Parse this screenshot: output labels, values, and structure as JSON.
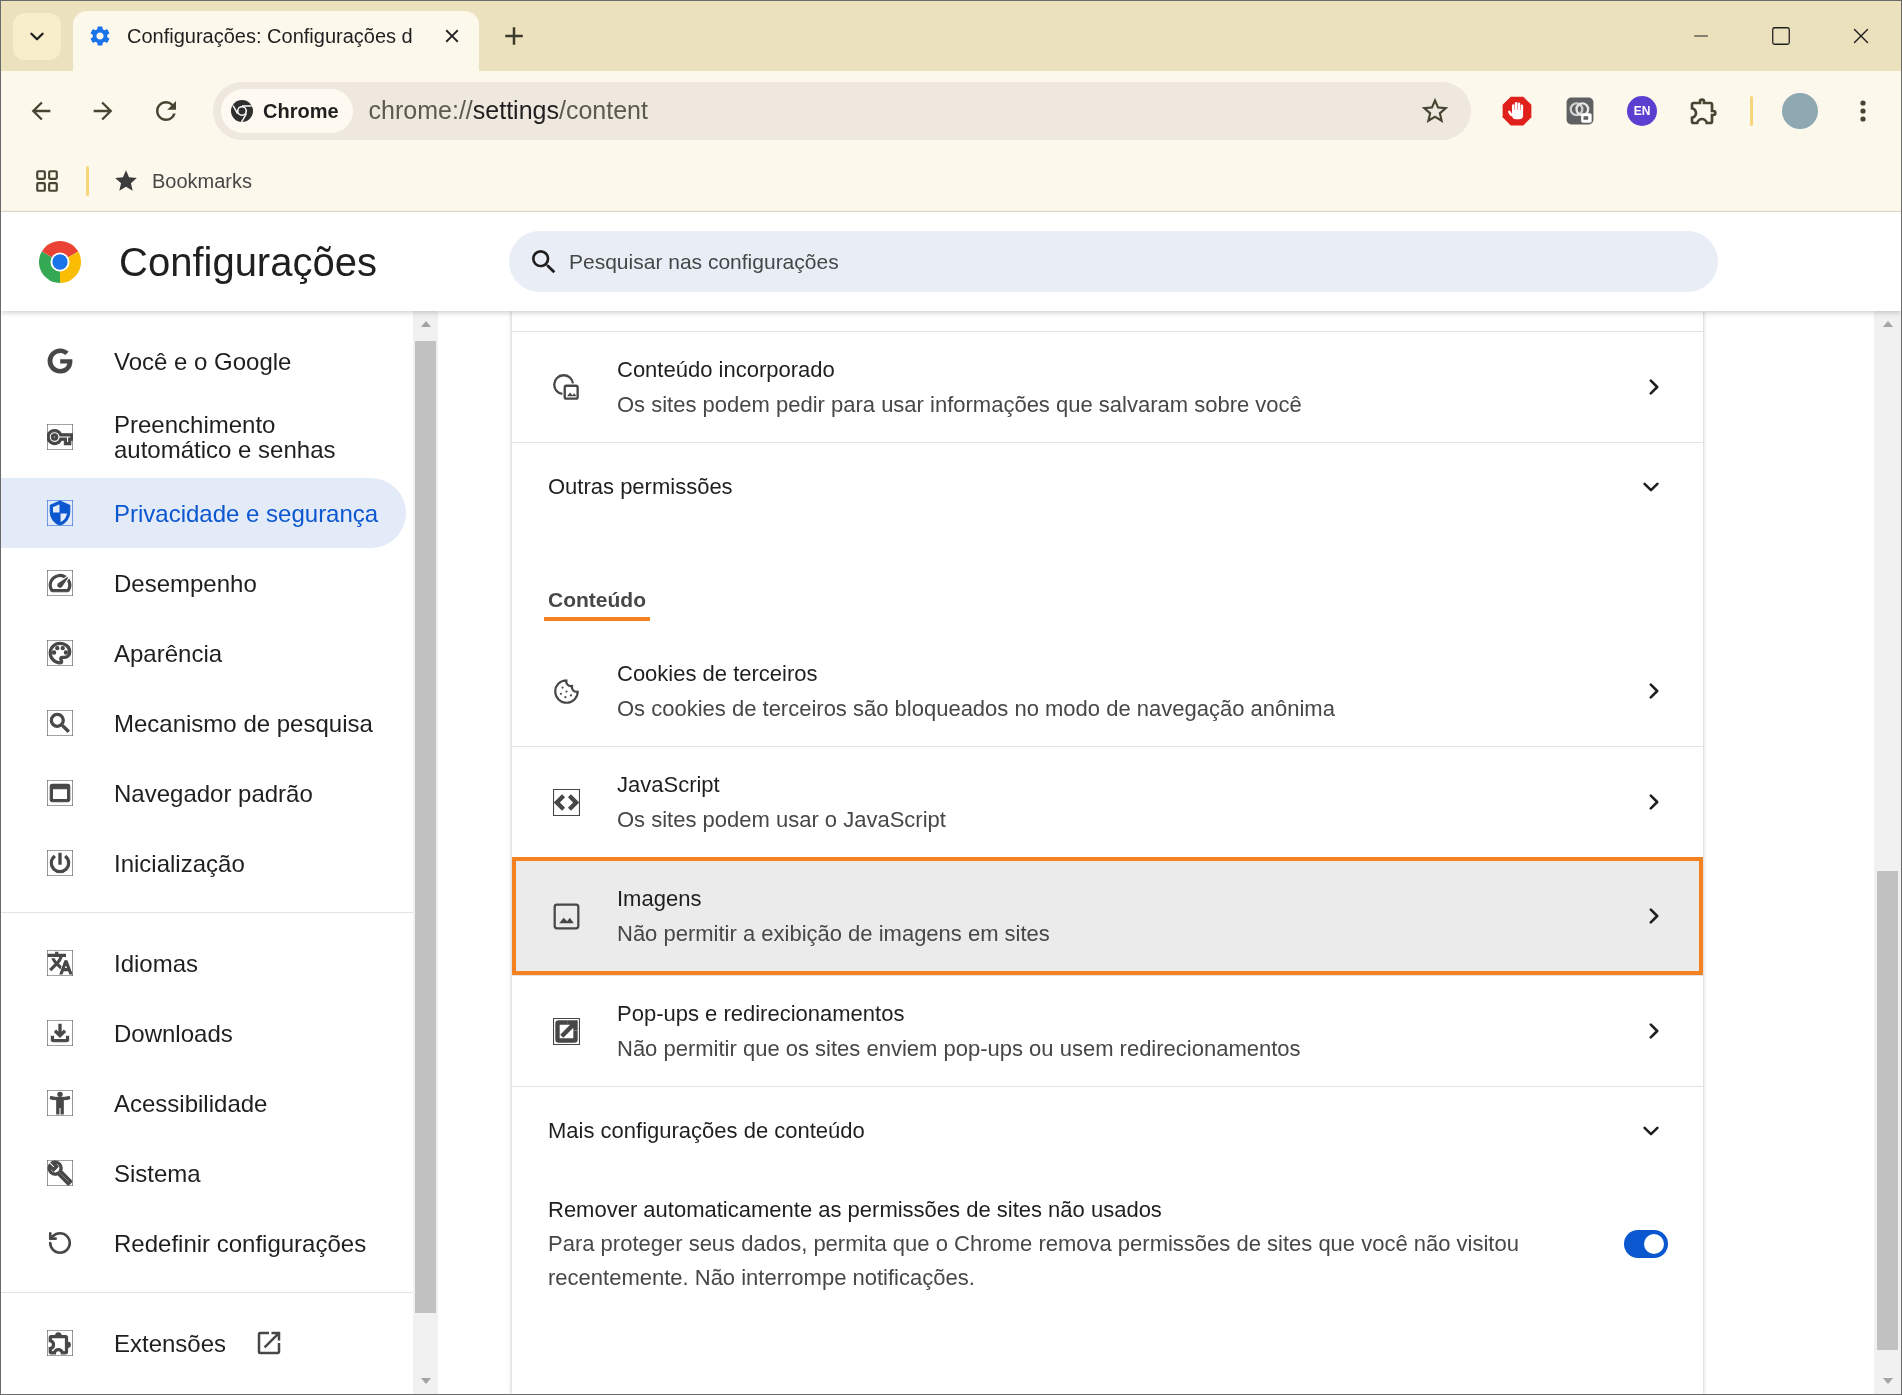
{
  "tabs": [
    {
      "title": "Configurações: Configurações d",
      "selected": true
    }
  ],
  "toolbar": {
    "site_chip": "Chrome",
    "url": {
      "scheme": "chrome://",
      "host": "settings",
      "path": "/content"
    },
    "extension_badge": "EN"
  },
  "bookmarks_bar": {
    "folder": "Bookmarks"
  },
  "header": {
    "title": "Configurações",
    "search": {
      "placeholder": "Pesquisar nas configurações"
    }
  },
  "sidebar": {
    "groups": [
      {
        "items": [
          {
            "label": "Você e o Google",
            "selected": false
          },
          {
            "label": "Preenchimento automático e senhas",
            "selected": false
          },
          {
            "label": "Privacidade e segurança",
            "selected": true
          },
          {
            "label": "Desempenho",
            "selected": false
          },
          {
            "label": "Aparência",
            "selected": false
          },
          {
            "label": "Mecanismo de pesquisa",
            "selected": false
          },
          {
            "label": "Navegador padrão",
            "selected": false
          },
          {
            "label": "Inicialização",
            "selected": false
          }
        ]
      },
      {
        "items": [
          {
            "label": "Idiomas",
            "selected": false
          },
          {
            "label": "Downloads",
            "selected": false
          },
          {
            "label": "Acessibilidade",
            "selected": false
          },
          {
            "label": "Sistema",
            "selected": false
          },
          {
            "label": "Redefinir configurações",
            "selected": false
          }
        ]
      },
      {
        "items": [
          {
            "label": "Extensões",
            "selected": false,
            "external": true
          }
        ]
      }
    ]
  },
  "content": {
    "rows": [
      {
        "kind": "link",
        "title": "Conteúdo incorporado",
        "subtitle": "Os sites podem pedir para usar informações que salvaram sobre você",
        "highlighted": false
      },
      {
        "kind": "expander",
        "title": "Outras permissões",
        "expanded": false
      },
      {
        "kind": "heading",
        "title": "Conteúdo",
        "underlined": true
      },
      {
        "kind": "link",
        "title": "Cookies de terceiros",
        "subtitle": "Os cookies de terceiros são bloqueados no modo de navegação anônima",
        "highlighted": false
      },
      {
        "kind": "link",
        "title": "JavaScript",
        "subtitle": "Os sites podem usar o JavaScript",
        "highlighted": false
      },
      {
        "kind": "link",
        "title": "Imagens",
        "subtitle": "Não permitir a exibição de imagens em sites",
        "highlighted": true
      },
      {
        "kind": "link",
        "title": "Pop-ups e redirecionamentos",
        "subtitle": "Não permitir que os sites enviem pop-ups ou usem redirecionamentos",
        "highlighted": false
      },
      {
        "kind": "expander",
        "title": "Mais configurações de conteúdo",
        "expanded": false
      },
      {
        "kind": "toggle",
        "title": "Remover automaticamente as permissões de sites não usados",
        "description": "Para proteger seus dados, permita que o Chrome remova permissões de sites que você não visitou recentemente. Não interrompe notificações.",
        "on": true
      }
    ]
  }
}
